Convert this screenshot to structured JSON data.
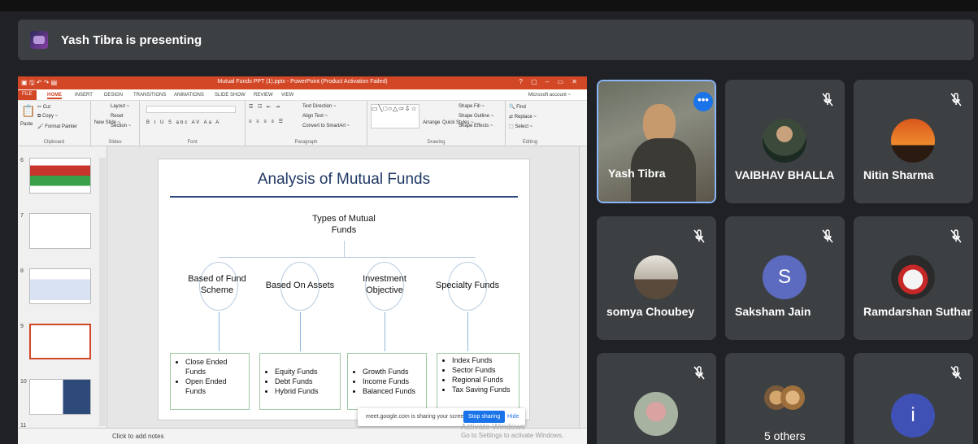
{
  "presenting": {
    "text": "Yash Tibra is presenting"
  },
  "ppt": {
    "window_title": "Mutual Funds PPT (1).pptx - PowerPoint (Product Activation Failed)",
    "window_controls": "? ▢ – ▭ ✕",
    "tabs": [
      "FILE",
      "HOME",
      "INSERT",
      "DESIGN",
      "TRANSITIONS",
      "ANIMATIONS",
      "SLIDE SHOW",
      "REVIEW",
      "VIEW"
    ],
    "account": "Microsoft account ~",
    "ribbon": {
      "clipboard": {
        "paste": "Paste",
        "cut": "Cut",
        "copy": "Copy ~",
        "format_painter": "Format Painter",
        "label": "Clipboard"
      },
      "slides": {
        "new_slide": "New Slide ~",
        "layout": "Layout ~",
        "reset": "Reset",
        "section": "Section ~",
        "label": "Slides"
      },
      "font": {
        "label": "Font"
      },
      "paragraph": {
        "text_direction": "Text Direction ~",
        "align_text": "Align Text ~",
        "convert": "Convert to SmartArt ~",
        "label": "Paragraph"
      },
      "drawing": {
        "arrange": "Arrange",
        "quick_styles": "Quick Styles ~",
        "shape_fill": "Shape Fill ~",
        "shape_outline": "Shape Outline ~",
        "shape_effects": "Shape Effects ~",
        "label": "Drawing"
      },
      "editing": {
        "find": "Find",
        "replace": "Replace ~",
        "select": "Select ~",
        "label": "Editing"
      }
    },
    "thumbnails": [
      {
        "num": "6"
      },
      {
        "num": "7"
      },
      {
        "num": "8"
      },
      {
        "num": "9"
      },
      {
        "num": "10"
      },
      {
        "num": "11"
      }
    ],
    "notes_placeholder": "Click to add notes"
  },
  "slide": {
    "title": "Analysis of Mutual Funds",
    "root": "Types of Mutual Funds",
    "categories": [
      {
        "label": "Based of Fund Scheme",
        "items": [
          "Close Ended Funds",
          "Open Ended Funds"
        ]
      },
      {
        "label": "Based On Assets",
        "items": [
          "Equity Funds",
          "Debt Funds",
          "Hybrid Funds"
        ]
      },
      {
        "label": "Investment Objective",
        "items": [
          "Growth Funds",
          "Income Funds",
          "Balanced Funds"
        ]
      },
      {
        "label": "Specialty Funds",
        "items": [
          "Index Funds",
          "Sector Funds",
          "Regional Funds",
          "Tax Saving Funds"
        ]
      }
    ]
  },
  "share_toast": {
    "message": "meet.google.com is sharing your screen.",
    "stop": "Stop sharing",
    "hide": "Hide"
  },
  "activate": {
    "line1": "Activate Windows",
    "line2": "Go to Settings to activate Windows."
  },
  "participants": [
    {
      "name": "Yash Tibra",
      "muted": false,
      "type": "video"
    },
    {
      "name": "VAIBHAV BHALLA",
      "muted": true,
      "type": "photo"
    },
    {
      "name": "Nitin Sharma",
      "muted": true,
      "type": "photo"
    },
    {
      "name": "somya Choubey",
      "muted": true,
      "type": "photo"
    },
    {
      "name": "Saksham Jain",
      "muted": true,
      "type": "letter",
      "letter": "S",
      "color": "#5c6bc0"
    },
    {
      "name": "Ramdarshan Suthar",
      "muted": true,
      "type": "photo"
    },
    {
      "name": "",
      "muted": true,
      "type": "photo"
    },
    {
      "name": "5 others",
      "muted": false,
      "type": "group"
    },
    {
      "name": "",
      "muted": true,
      "type": "letter",
      "letter": "i",
      "color": "#3f51b5"
    }
  ],
  "colors": {
    "meet_bg": "#202124",
    "tile_bg": "#3c4043",
    "accent": "#1a73e8",
    "ppt_accent": "#d24726"
  }
}
